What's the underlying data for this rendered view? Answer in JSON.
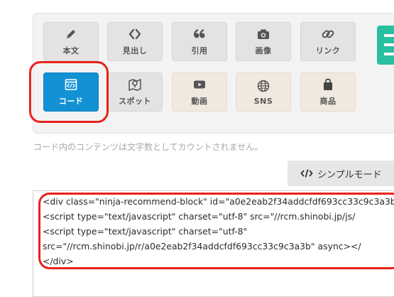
{
  "toolbar": {
    "row1": [
      {
        "label": "本文",
        "icon": "pencil-icon"
      },
      {
        "label": "見出し",
        "icon": "angle-brackets-icon"
      },
      {
        "label": "引用",
        "icon": "quote-icon"
      },
      {
        "label": "画像",
        "icon": "camera-icon"
      },
      {
        "label": "リンク",
        "icon": "link-icon"
      }
    ],
    "row2": [
      {
        "label": "コード",
        "icon": "code-window-icon"
      },
      {
        "label": "スポット",
        "icon": "map-pin-icon"
      },
      {
        "label": "動画",
        "icon": "video-play-icon"
      },
      {
        "label": "SNS",
        "icon": "globe-icon"
      },
      {
        "label": "商品",
        "icon": "shopping-bag-icon"
      }
    ],
    "active": "コード"
  },
  "note": "コード内のコンテンツは文字数としてカウントされません。",
  "mode_button": {
    "label": "シンプルモード",
    "icon": "code-slash-icon"
  },
  "code": [
    "<div class=\"ninja-recommend-block\" id=\"a0e2eab2f34addcfdf693cc33c9c3a3b\"",
    "<script type=\"text/javascript\" charset=\"utf-8\" src=\"//rcm.shinobi.jp/js/",
    "<script type=\"text/javascript\" charset=\"utf-8\"",
    "src=\"//rcm.shinobi.jp/r/a0e2eab2f34addcfdf693cc33c9c3a3b\" async></",
    "</div>"
  ],
  "colors": {
    "accent_blue": "#1391d5",
    "highlight_red": "#e8221b",
    "teal": "#29bfa0"
  }
}
